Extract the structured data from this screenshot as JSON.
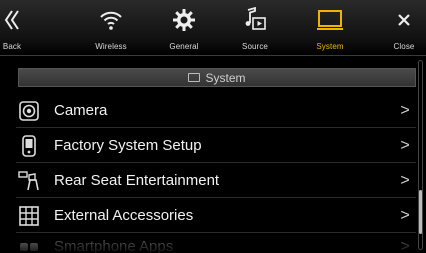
{
  "topbar": {
    "tabs": [
      {
        "id": "back",
        "label": "Back",
        "icon": "back-icon",
        "active": false
      },
      {
        "id": "wireless",
        "label": "Wireless",
        "icon": "wireless-icon",
        "active": false
      },
      {
        "id": "general",
        "label": "General",
        "icon": "gear-icon",
        "active": false
      },
      {
        "id": "source",
        "label": "Source",
        "icon": "music-source-icon",
        "active": false
      },
      {
        "id": "system",
        "label": "System",
        "icon": "monitor-icon",
        "active": true
      },
      {
        "id": "close",
        "label": "Close",
        "icon": "close-icon",
        "active": false
      }
    ],
    "active_color": "#f0b400"
  },
  "section": {
    "title": "System",
    "icon": "monitor-icon"
  },
  "list": {
    "items": [
      {
        "label": "Camera",
        "icon": "camera-icon"
      },
      {
        "label": "Factory System Setup",
        "icon": "phone-device-icon"
      },
      {
        "label": "Rear Seat Entertainment",
        "icon": "rear-seat-icon"
      },
      {
        "label": "External Accessories",
        "icon": "accessories-grid-icon"
      },
      {
        "label": "Smartphone Apps",
        "icon": "smartphone-apps-icon"
      }
    ],
    "chevron": ">"
  }
}
